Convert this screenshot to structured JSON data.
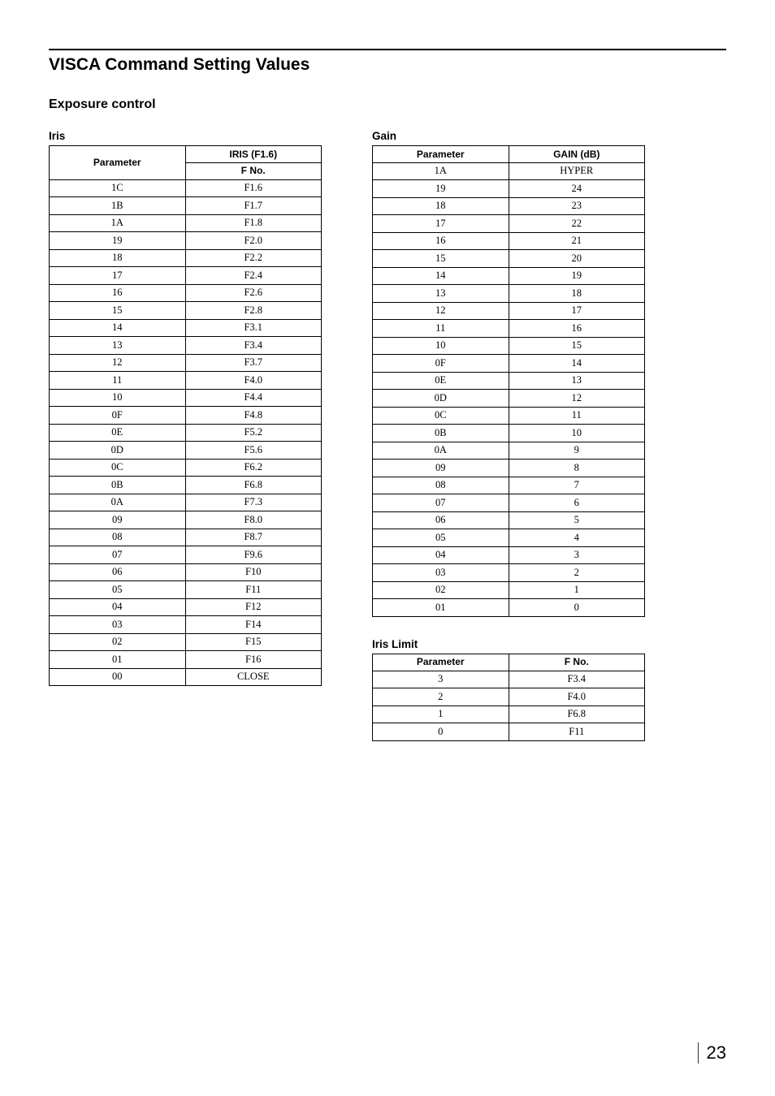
{
  "page_title": "VISCA Command Setting Values",
  "section_title": "Exposure control",
  "iris": {
    "title": "Iris",
    "header_param": "Parameter",
    "header_group": "IRIS (F1.6)",
    "header_sub": "F No.",
    "rows": [
      {
        "p": "1C",
        "v": "F1.6"
      },
      {
        "p": "1B",
        "v": "F1.7"
      },
      {
        "p": "1A",
        "v": "F1.8"
      },
      {
        "p": "19",
        "v": "F2.0"
      },
      {
        "p": "18",
        "v": "F2.2"
      },
      {
        "p": "17",
        "v": "F2.4"
      },
      {
        "p": "16",
        "v": "F2.6"
      },
      {
        "p": "15",
        "v": "F2.8"
      },
      {
        "p": "14",
        "v": "F3.1"
      },
      {
        "p": "13",
        "v": "F3.4"
      },
      {
        "p": "12",
        "v": "F3.7"
      },
      {
        "p": "11",
        "v": "F4.0"
      },
      {
        "p": "10",
        "v": "F4.4"
      },
      {
        "p": "0F",
        "v": "F4.8"
      },
      {
        "p": "0E",
        "v": "F5.2"
      },
      {
        "p": "0D",
        "v": "F5.6"
      },
      {
        "p": "0C",
        "v": "F6.2"
      },
      {
        "p": "0B",
        "v": "F6.8"
      },
      {
        "p": "0A",
        "v": "F7.3"
      },
      {
        "p": "09",
        "v": "F8.0"
      },
      {
        "p": "08",
        "v": "F8.7"
      },
      {
        "p": "07",
        "v": "F9.6"
      },
      {
        "p": "06",
        "v": "F10"
      },
      {
        "p": "05",
        "v": "F11"
      },
      {
        "p": "04",
        "v": "F12"
      },
      {
        "p": "03",
        "v": "F14"
      },
      {
        "p": "02",
        "v": "F15"
      },
      {
        "p": "01",
        "v": "F16"
      },
      {
        "p": "00",
        "v": "CLOSE"
      }
    ]
  },
  "gain": {
    "title": "Gain",
    "header_param": "Parameter",
    "header_value": "GAIN (dB)",
    "rows": [
      {
        "p": "1A",
        "v": "HYPER"
      },
      {
        "p": "19",
        "v": "24"
      },
      {
        "p": "18",
        "v": "23"
      },
      {
        "p": "17",
        "v": "22"
      },
      {
        "p": "16",
        "v": "21"
      },
      {
        "p": "15",
        "v": "20"
      },
      {
        "p": "14",
        "v": "19"
      },
      {
        "p": "13",
        "v": "18"
      },
      {
        "p": "12",
        "v": "17"
      },
      {
        "p": "11",
        "v": "16"
      },
      {
        "p": "10",
        "v": "15"
      },
      {
        "p": "0F",
        "v": "14"
      },
      {
        "p": "0E",
        "v": "13"
      },
      {
        "p": "0D",
        "v": "12"
      },
      {
        "p": "0C",
        "v": "11"
      },
      {
        "p": "0B",
        "v": "10"
      },
      {
        "p": "0A",
        "v": "9"
      },
      {
        "p": "09",
        "v": "8"
      },
      {
        "p": "08",
        "v": "7"
      },
      {
        "p": "07",
        "v": "6"
      },
      {
        "p": "06",
        "v": "5"
      },
      {
        "p": "05",
        "v": "4"
      },
      {
        "p": "04",
        "v": "3"
      },
      {
        "p": "03",
        "v": "2"
      },
      {
        "p": "02",
        "v": "1"
      },
      {
        "p": "01",
        "v": "0"
      }
    ]
  },
  "iris_limit": {
    "title": "Iris Limit",
    "header_param": "Parameter",
    "header_value": "F No.",
    "rows": [
      {
        "p": "3",
        "v": "F3.4"
      },
      {
        "p": "2",
        "v": "F4.0"
      },
      {
        "p": "1",
        "v": "F6.8"
      },
      {
        "p": "0",
        "v": "F11"
      }
    ]
  },
  "page_number": "23"
}
